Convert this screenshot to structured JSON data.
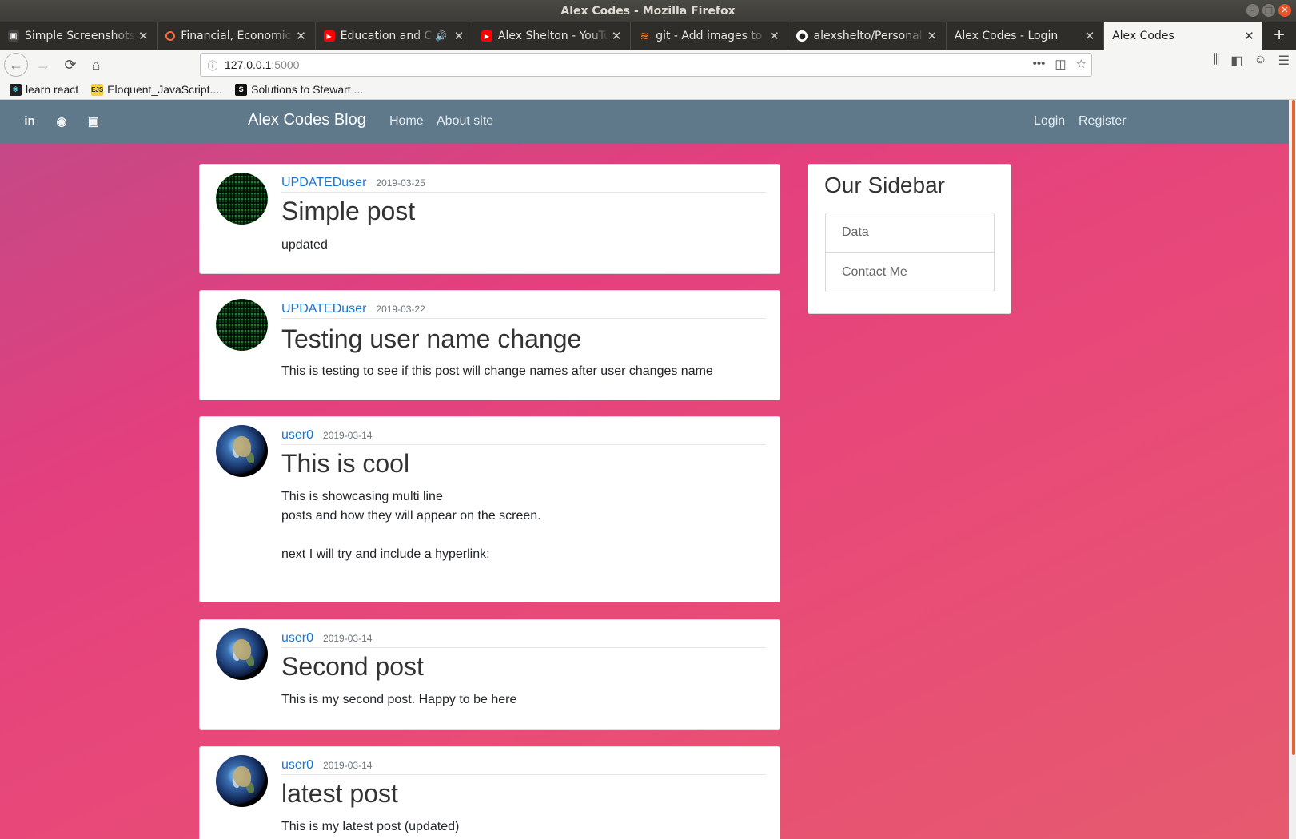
{
  "window": {
    "title": "Alex Codes - Mozilla Firefox"
  },
  "tabs": [
    {
      "title": "Simple Screenshots",
      "icon": "screenshot-favicon",
      "color": "#444444"
    },
    {
      "title": "Financial, Economic",
      "icon": "ring-favicon",
      "color": "#ff6a3d"
    },
    {
      "title": "Education and Co",
      "icon": "youtube-favicon",
      "color": "#ff0000",
      "audio": "🔊"
    },
    {
      "title": "Alex Shelton - YouTu",
      "icon": "youtube-favicon",
      "color": "#ff0000"
    },
    {
      "title": "git - Add images to R",
      "icon": "stackoverflow-favicon",
      "color": "#f48024"
    },
    {
      "title": "alexshelto/Personal",
      "icon": "github-favicon",
      "color": "#ffffff"
    },
    {
      "title": "Alex Codes - Login",
      "icon": "none",
      "color": ""
    },
    {
      "title": "Alex Codes",
      "icon": "none",
      "color": "",
      "active": true
    }
  ],
  "toolbar": {
    "url_host": "127.0.0.1",
    "url_port": ":5000"
  },
  "bookmarks": [
    {
      "label": "learn react",
      "icon": "react-favicon"
    },
    {
      "label": "Eloquent_JavaScript....",
      "icon": "ejs-favicon",
      "badge": "EJS"
    },
    {
      "label": "Solutions to Stewart ...",
      "icon": "s-favicon",
      "badge": "S"
    }
  ],
  "site": {
    "brand": "Alex Codes Blog",
    "nav": {
      "home": "Home",
      "about": "About site",
      "login": "Login",
      "register": "Register"
    },
    "social": [
      "in",
      "github",
      "youtube"
    ]
  },
  "posts": [
    {
      "author": "UPDATEDuser",
      "date": "2019-03-25",
      "title": "Simple post",
      "body": "updated",
      "avatar": "matrix"
    },
    {
      "author": "UPDATEDuser",
      "date": "2019-03-22",
      "title": "Testing user name change",
      "body": "This is testing to see if this post will change names after user changes name",
      "avatar": "matrix"
    },
    {
      "author": "user0",
      "date": "2019-03-14",
      "title": "This is cool",
      "body": "This is showcasing multi line\nposts and how they will appear on the screen.\n\nnext I will try and include a hyperlink:",
      "avatar": "earth"
    },
    {
      "author": "user0",
      "date": "2019-03-14",
      "title": "Second post",
      "body": "This is my second post. Happy to be here",
      "avatar": "earth"
    },
    {
      "author": "user0",
      "date": "2019-03-14",
      "title": "latest post",
      "body": "This is my latest post (updated)",
      "avatar": "earth"
    }
  ],
  "sidebar": {
    "title": "Our Sidebar",
    "items": [
      "Data",
      "Contact Me"
    ]
  }
}
